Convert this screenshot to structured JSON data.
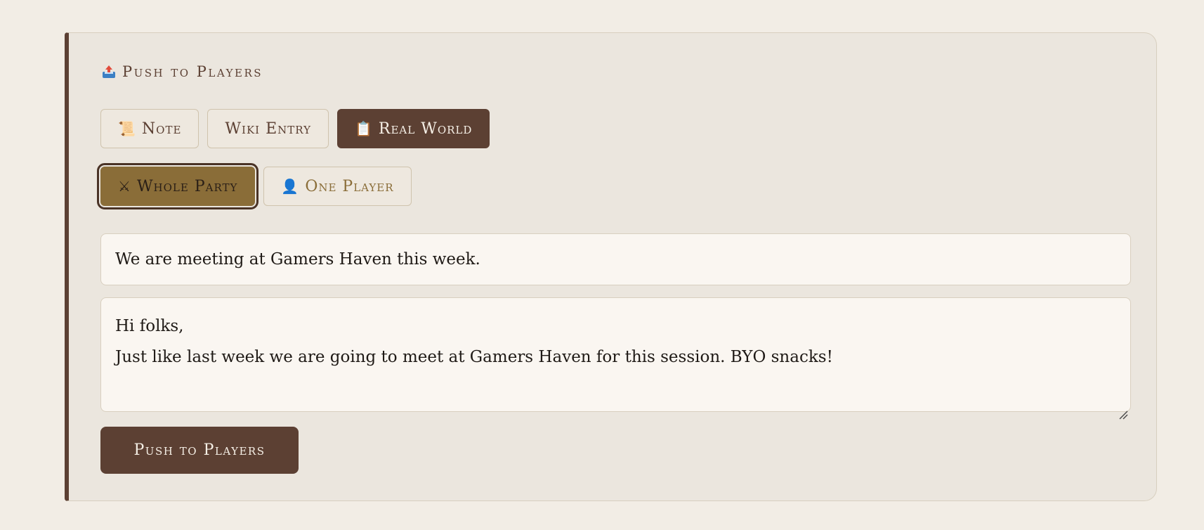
{
  "panel": {
    "title": "Push to Players",
    "title_icon": "outbox-tray-icon"
  },
  "content_types": [
    {
      "label": "Note",
      "icon": "scroll-icon",
      "glyph": "📜",
      "selected": false
    },
    {
      "label": "Wiki Entry",
      "icon": "",
      "glyph": "",
      "selected": false
    },
    {
      "label": "Real World",
      "icon": "clipboard-icon",
      "glyph": "📋",
      "selected": true
    }
  ],
  "targets": [
    {
      "label": "Whole Party",
      "icon": "crossed-swords-icon",
      "glyph": "⚔",
      "selected": true
    },
    {
      "label": "One Player",
      "icon": "person-icon",
      "glyph": "👤",
      "selected": false
    }
  ],
  "subject": {
    "value": "We are meeting at Gamers Haven this week."
  },
  "message": {
    "line1": "Hi folks,",
    "line2": "Just like last week we are going to meet at Gamers Haven for this session. BYO snacks!"
  },
  "submit": {
    "label": "Push to Players"
  },
  "colors": {
    "accent": "#5c4033",
    "target_active": "#8a6d38",
    "background": "#f2ede5",
    "panel": "#ebe6de"
  }
}
